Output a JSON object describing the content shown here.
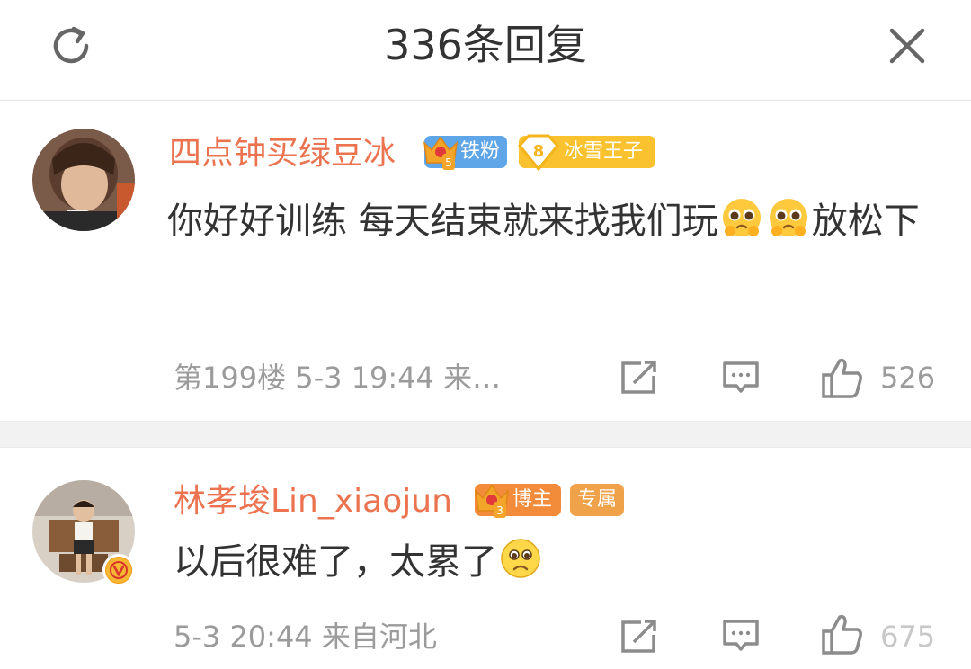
{
  "header": {
    "title": "336条回复",
    "refresh_icon": "refresh-icon",
    "close_icon": "close-icon"
  },
  "comments": [
    {
      "username": "四点钟买绿豆冰",
      "badges": [
        "铁粉",
        "冰雪王子"
      ],
      "badge_level": "8",
      "content_text": "你好好训练 每天结束就来找我们玩",
      "content_tail": "放松下",
      "emoji": "pleading-face-emoji",
      "meta": "第199楼 5-3 19:44 来…",
      "likes": "526"
    },
    {
      "username": "林孝埈Lin_xiaojun",
      "badges": [
        "博主",
        "专属"
      ],
      "content_text": "以后很难了，太累了",
      "emoji": "sad-face-emoji",
      "meta": "5-3 20:44 来自河北",
      "likes": "675"
    }
  ],
  "colors": {
    "username": "#eb7350",
    "meta": "#9b9b9b",
    "divider": "#f2f2f2",
    "tiefen_badge": "#5fa6e8",
    "bingxue_badge": "#f9c22e",
    "bozhu_badge": "#f28b3a"
  }
}
